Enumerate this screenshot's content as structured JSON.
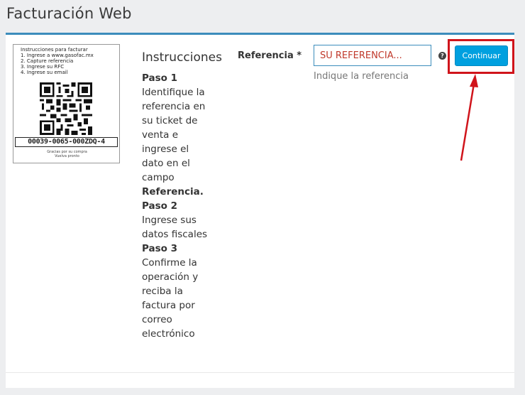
{
  "page": {
    "title": "Facturación Web"
  },
  "ticket": {
    "lines": [
      "Instrucciones para facturar",
      "1. Ingrese a www.gasofac.mx",
      "2. Capture referencia",
      "3. Ingrese su RFC",
      "4. Ingrese su email"
    ],
    "code": "00039-0065-000ZDQ-4",
    "thanks_1": "Gracias por su compra",
    "thanks_2": "Vuelva pronto"
  },
  "instructions": {
    "title": "Instrucciones",
    "step1_label": "Paso 1",
    "step1_text": "Identifique la referencia en su ticket de venta e ingrese el dato en el campo",
    "step1_field": "Referencia.",
    "step2_label": "Paso 2",
    "step2_text": "Ingrese sus datos fiscales",
    "step3_label": "Paso 3",
    "step3_text": "Confirme la operación y reciba la factura por correo electrónico"
  },
  "form": {
    "ref_label": "Referencia *",
    "ref_placeholder": "SU REFERENCIA...",
    "ref_value": "",
    "help_icon": "question-circle-icon",
    "ref_help": "Indique la referencia",
    "continue_label": "Continuar"
  },
  "colors": {
    "accent": "#3c8dbc",
    "button": "#00a0df",
    "highlight": "#d0141b",
    "placeholder": "#c0392b"
  }
}
